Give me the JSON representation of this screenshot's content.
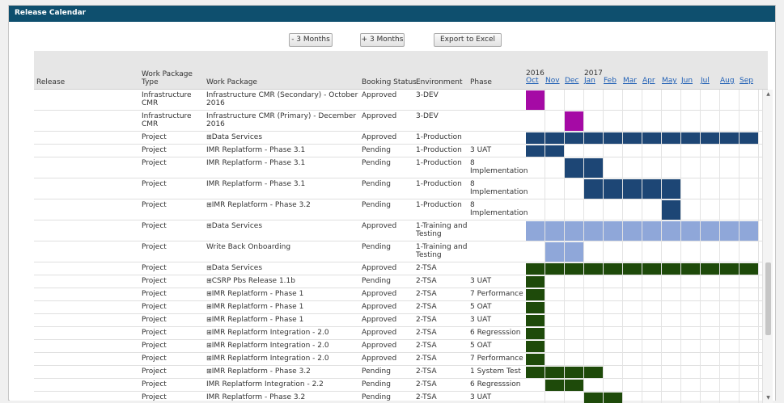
{
  "panel": {
    "title": "Release Calendar"
  },
  "toolbar": {
    "minus_label": "- 3 Months",
    "plus_label": "+ 3 Months",
    "export_label": "Export to Excel"
  },
  "columns": {
    "release": "Release",
    "type": "Work Package Type",
    "wp": "Work Package",
    "status": "Booking Status",
    "env": "Environment",
    "phase": "Phase"
  },
  "years": [
    {
      "label": "2016",
      "col": 0
    },
    {
      "label": "2017",
      "col": 3
    }
  ],
  "months": [
    "Oct",
    "Nov",
    "Dec",
    "Jan",
    "Feb",
    "Mar",
    "Apr",
    "May",
    "Jun",
    "Jul",
    "Aug",
    "Sep"
  ],
  "colors": {
    "3-DEV": "#a50aa5",
    "1-Production": "#1d4675",
    "1-Training and Testing": "#8fa7d9",
    "2-TSA": "#1e4a0a"
  },
  "rows": [
    {
      "release": "",
      "type": "Infrastructure CMR",
      "wp": "Infrastructure CMR (Secondary) - October 2016",
      "expand": false,
      "status": "Approved",
      "env": "3-DEV",
      "phase": "",
      "start": 0,
      "span": 1
    },
    {
      "release": "",
      "type": "Infrastructure CMR",
      "wp": "Infrastructure CMR (Primary) - December 2016",
      "expand": false,
      "status": "Approved",
      "env": "3-DEV",
      "phase": "",
      "start": 2,
      "span": 1
    },
    {
      "release": "",
      "type": "Project",
      "wp": "Data Services",
      "expand": true,
      "status": "Approved",
      "env": "1-Production",
      "phase": "",
      "start": 0,
      "span": 12
    },
    {
      "release": "",
      "type": "Project",
      "wp": "IMR Replatform - Phase 3.1",
      "expand": false,
      "status": "Pending",
      "env": "1-Production",
      "phase": "3 UAT",
      "start": 0,
      "span": 2
    },
    {
      "release": "",
      "type": "Project",
      "wp": "IMR Replatform - Phase 3.1",
      "expand": false,
      "status": "Pending",
      "env": "1-Production",
      "phase": "8 Implementation",
      "start": 2,
      "span": 2
    },
    {
      "release": "",
      "type": "Project",
      "wp": "IMR Replatform - Phase 3.1",
      "expand": false,
      "status": "Pending",
      "env": "1-Production",
      "phase": "8 Implementation",
      "start": 3,
      "span": 5
    },
    {
      "release": "",
      "type": "Project",
      "wp": "IMR Replatform - Phase 3.2",
      "expand": true,
      "status": "Pending",
      "env": "1-Production",
      "phase": "8 Implementation",
      "start": 7,
      "span": 1
    },
    {
      "release": "",
      "type": "Project",
      "wp": "Data Services",
      "expand": true,
      "status": "Approved",
      "env": "1-Training and Testing",
      "phase": "",
      "start": 0,
      "span": 12
    },
    {
      "release": "",
      "type": "Project",
      "wp": "Write Back Onboarding",
      "expand": false,
      "status": "Pending",
      "env": "1-Training and Testing",
      "phase": "",
      "start": 1,
      "span": 2
    },
    {
      "release": "",
      "type": "Project",
      "wp": "Data Services",
      "expand": true,
      "status": "Approved",
      "env": "2-TSA",
      "phase": "",
      "start": 0,
      "span": 12
    },
    {
      "release": "",
      "type": "Project",
      "wp": "CSRP Pbs Release 1.1b",
      "expand": true,
      "status": "Pending",
      "env": "2-TSA",
      "phase": "3 UAT",
      "start": 0,
      "span": 1
    },
    {
      "release": "",
      "type": "Project",
      "wp": "IMR Replatform - Phase 1",
      "expand": true,
      "status": "Approved",
      "env": "2-TSA",
      "phase": "7 Performance",
      "start": 0,
      "span": 1
    },
    {
      "release": "",
      "type": "Project",
      "wp": "IMR Replatform - Phase 1",
      "expand": true,
      "status": "Approved",
      "env": "2-TSA",
      "phase": "5 OAT",
      "start": 0,
      "span": 1
    },
    {
      "release": "",
      "type": "Project",
      "wp": "IMR Replatform - Phase 1",
      "expand": true,
      "status": "Approved",
      "env": "2-TSA",
      "phase": "3 UAT",
      "start": 0,
      "span": 1
    },
    {
      "release": "",
      "type": "Project",
      "wp": "IMR Replatform Integration - 2.0",
      "expand": true,
      "status": "Approved",
      "env": "2-TSA",
      "phase": "6 Regresssion",
      "start": 0,
      "span": 1
    },
    {
      "release": "",
      "type": "Project",
      "wp": "IMR Replatform Integration - 2.0",
      "expand": true,
      "status": "Approved",
      "env": "2-TSA",
      "phase": "5 OAT",
      "start": 0,
      "span": 1
    },
    {
      "release": "",
      "type": "Project",
      "wp": "IMR Replatform Integration - 2.0",
      "expand": true,
      "status": "Approved",
      "env": "2-TSA",
      "phase": "7 Performance",
      "start": 0,
      "span": 1
    },
    {
      "release": "",
      "type": "Project",
      "wp": "IMR Replatform - Phase 3.2",
      "expand": true,
      "status": "Pending",
      "env": "2-TSA",
      "phase": "1 System Test",
      "start": 0,
      "span": 4
    },
    {
      "release": "",
      "type": "Project",
      "wp": "IMR Replatform Integration - 2.2",
      "expand": false,
      "status": "Pending",
      "env": "2-TSA",
      "phase": "6 Regresssion",
      "start": 1,
      "span": 2
    },
    {
      "release": "",
      "type": "Project",
      "wp": "IMR Replatform - Phase 3.2",
      "expand": false,
      "status": "Pending",
      "env": "2-TSA",
      "phase": "3 UAT",
      "start": 3,
      "span": 2
    }
  ]
}
